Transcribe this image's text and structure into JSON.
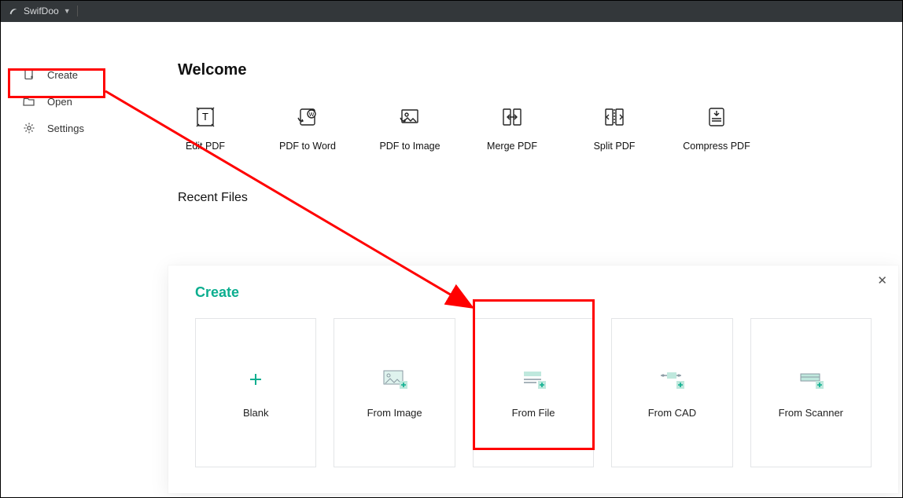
{
  "titlebar": {
    "app_name": "SwifDoo"
  },
  "sidebar": {
    "items": [
      {
        "label": "Create",
        "icon": "create"
      },
      {
        "label": "Open",
        "icon": "open"
      },
      {
        "label": "Settings",
        "icon": "settings"
      }
    ]
  },
  "main": {
    "welcome_heading": "Welcome",
    "quick_actions": [
      {
        "label": "Edit PDF"
      },
      {
        "label": "PDF to Word"
      },
      {
        "label": "PDF to Image"
      },
      {
        "label": "Merge PDF"
      },
      {
        "label": "Split PDF"
      },
      {
        "label": "Compress PDF"
      }
    ],
    "recent_heading": "Recent Files"
  },
  "create_panel": {
    "title": "Create",
    "options": [
      {
        "label": "Blank"
      },
      {
        "label": "From Image"
      },
      {
        "label": "From File"
      },
      {
        "label": "From CAD"
      },
      {
        "label": "From Scanner"
      }
    ]
  }
}
